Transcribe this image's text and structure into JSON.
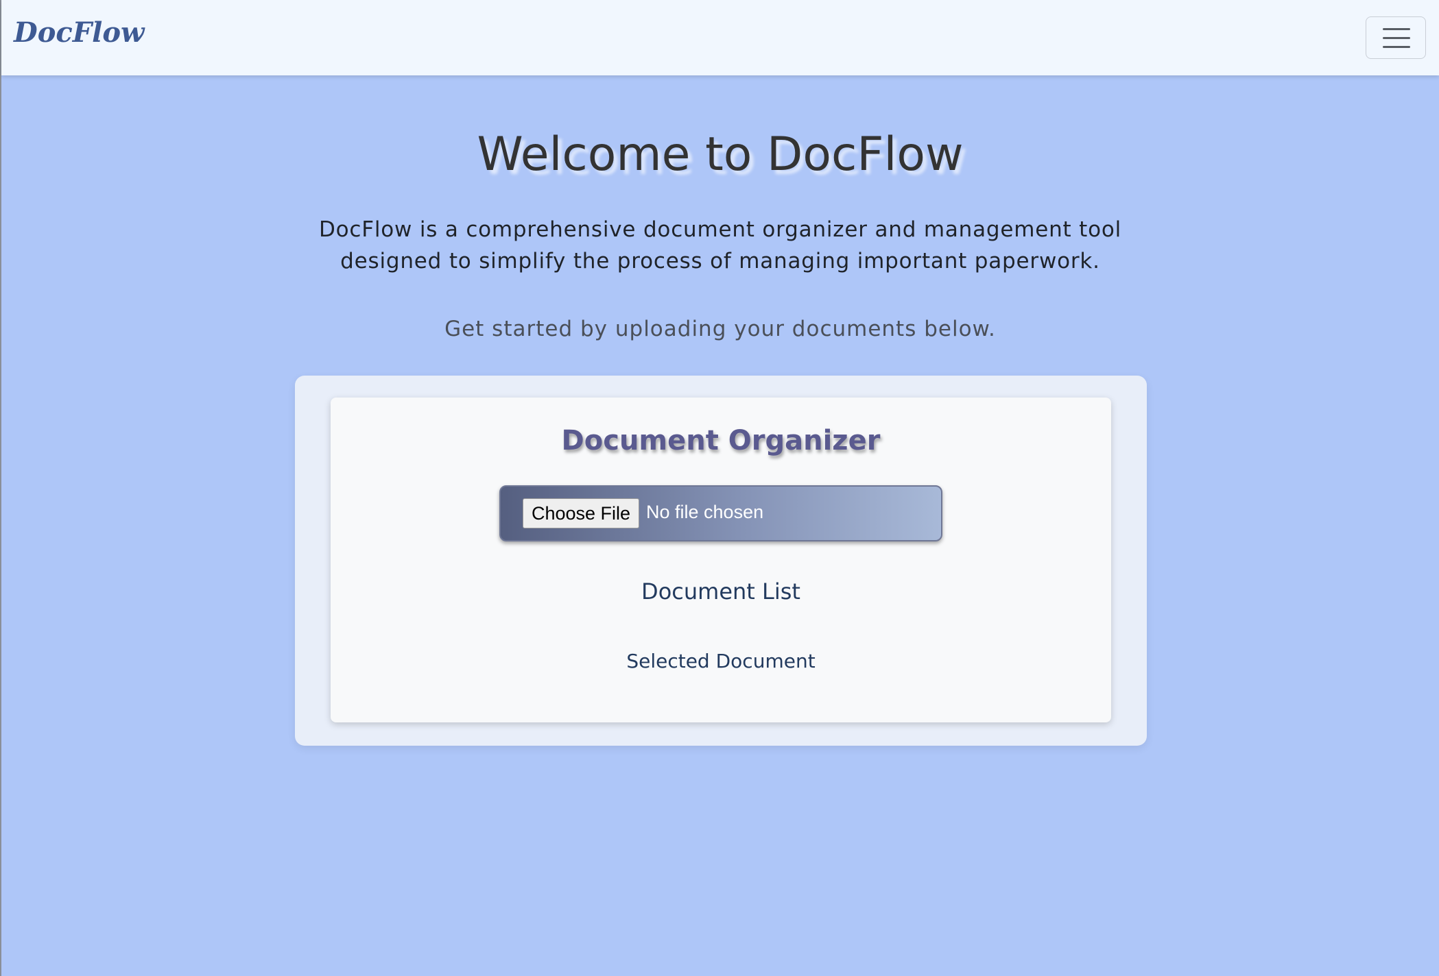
{
  "navbar": {
    "brand": "DocFlow",
    "toggle_icon": "hamburger-menu-icon"
  },
  "hero": {
    "title": "Welcome to DocFlow",
    "intro": "DocFlow is a comprehensive document organizer and management tool designed to simplify the process of managing important paperwork.",
    "cta": "Get started by uploading your documents below."
  },
  "organizer": {
    "title": "Document Organizer",
    "file_input": {
      "button_label": "Choose File",
      "status": "No file chosen"
    },
    "document_list_heading": "Document List",
    "selected_document_heading": "Selected Document"
  },
  "colors": {
    "page_background": "#aec6f8",
    "navbar_background": "#f1f7fe",
    "brand": "#3e5a93",
    "heading_text": "#223a5e",
    "organizer_title": "#5a5a8f"
  }
}
